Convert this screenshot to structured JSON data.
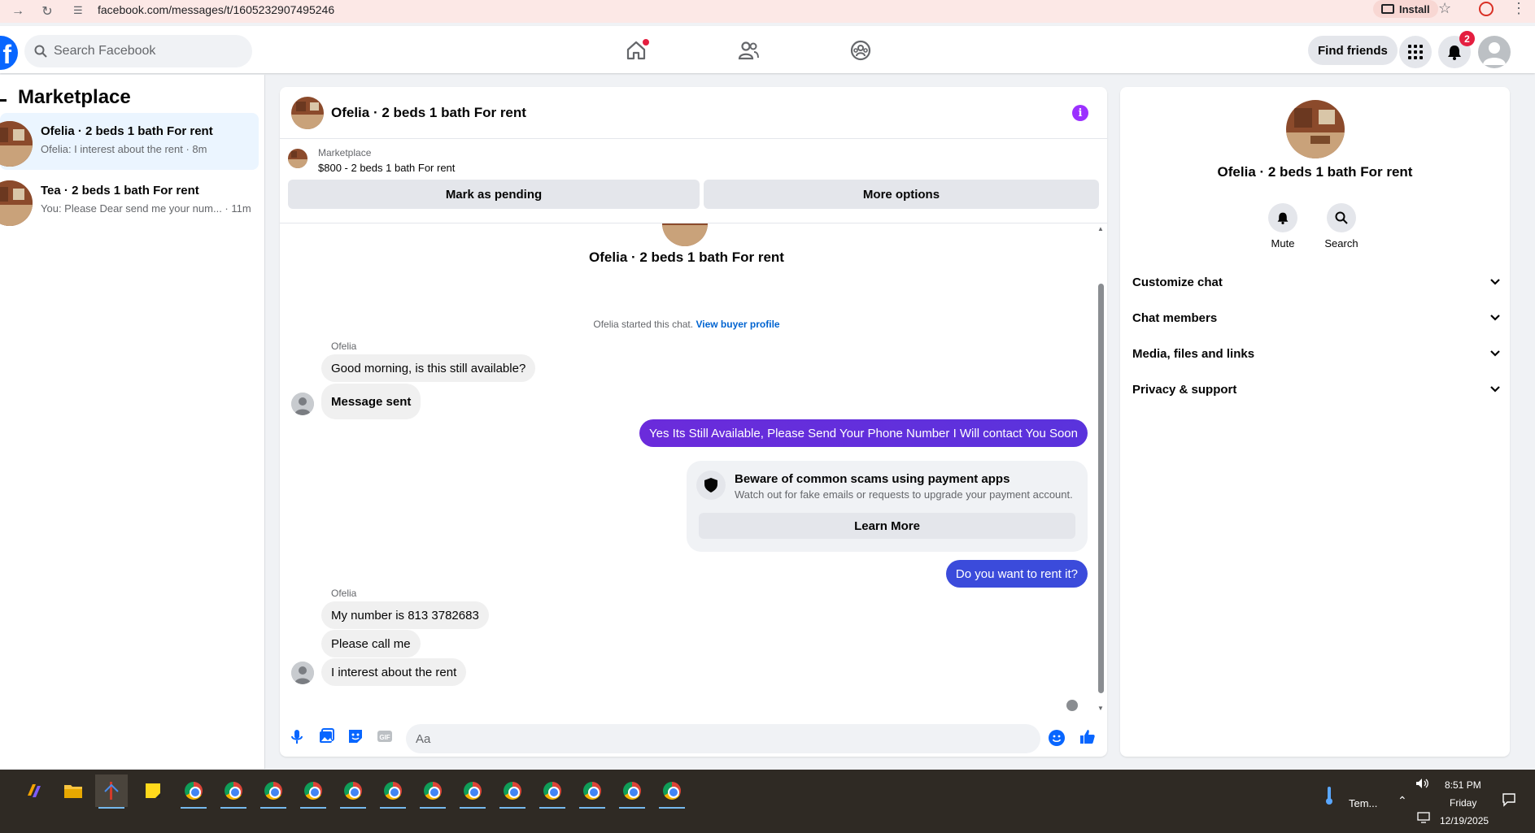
{
  "browser": {
    "url": "facebook.com/messages/t/1605232907495246",
    "install_label": "Install"
  },
  "header": {
    "search_placeholder": "Search Facebook",
    "find_friends_label": "Find friends",
    "notification_count": "2"
  },
  "sidebar": {
    "title": "Marketplace",
    "conversations": [
      {
        "name": "Ofelia · 2 beds 1 bath For rent",
        "preview": "Ofelia: I interest about the rent · 8m",
        "active": true
      },
      {
        "name": "Tea · 2 beds 1 bath For rent",
        "preview": "You: Please Dear send me your num... · 11m",
        "active": false
      }
    ]
  },
  "chat": {
    "title": "Ofelia · 2 beds 1 bath For rent",
    "listing_source": "Marketplace",
    "listing_price": "$800 - 2 beds 1 bath For rent",
    "mark_pending_label": "Mark as pending",
    "more_options_label": "More options",
    "thread_title": "Ofelia · 2 beds 1 bath For rent",
    "started_text": "Ofelia started this chat.",
    "view_profile_link": "View buyer profile",
    "sender_name": "Ofelia",
    "messages": [
      {
        "from": "Ofelia",
        "text": "Good morning, is this still available?"
      },
      {
        "from": "Ofelia",
        "text": "Message sent"
      },
      {
        "from": "me",
        "text": "Yes Its Still Available, Please Send Your Phone Number I Will contact You Soon"
      },
      {
        "from": "me",
        "text": "Do you want to rent it?"
      },
      {
        "from": "Ofelia",
        "text": "My number is 813 3782683"
      },
      {
        "from": "Ofelia",
        "text": "Please call me"
      },
      {
        "from": "Ofelia",
        "text": "I interest  about  the rent"
      }
    ],
    "scam_warning": {
      "title": "Beware of common scams using payment apps",
      "body": "Watch out for fake emails or requests to upgrade your payment account.",
      "button": "Learn More"
    },
    "composer_placeholder": "Aa"
  },
  "info_panel": {
    "name": "Ofelia · 2 beds 1 bath For rent",
    "mute_label": "Mute",
    "search_label": "Search",
    "sections": [
      "Customize chat",
      "Chat members",
      "Media, files and links",
      "Privacy & support"
    ]
  },
  "taskbar": {
    "weather_label": "Tem...",
    "time": "8:51 PM",
    "day": "Friday",
    "date": "12/19/2025"
  },
  "colors": {
    "fb_blue": "#0866ff",
    "outgoing_bubble_start": "#6b2bdb",
    "outgoing_bubble_end": "#3b4bdb",
    "info_purple": "#9b30ff"
  }
}
